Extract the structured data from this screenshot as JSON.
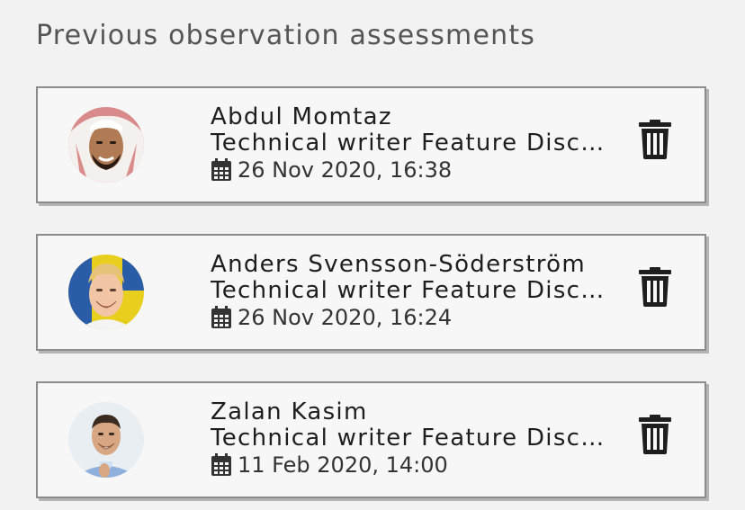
{
  "section": {
    "title": "Previous observation assessments"
  },
  "assessments": [
    {
      "name": "Abdul Momtaz",
      "description": "Technical writer Feature Discussion",
      "date": "26 Nov 2020, 16:38",
      "avatar": "avatar-photo-man-keffiyeh"
    },
    {
      "name": "Anders Svensson-Söderström",
      "description": "Technical writer Feature Discussion",
      "date": "26 Nov 2020, 16:24",
      "avatar": "avatar-photo-blond-man"
    },
    {
      "name": "Zalan Kasim",
      "description": "Technical writer Feature Discussion",
      "date": "11 Feb 2020, 14:00",
      "avatar": "avatar-photo-man-blue-shirt"
    }
  ],
  "icons": {
    "date": "calendar-icon",
    "delete": "trash-icon"
  },
  "colors": {
    "background": "#f2f2f2",
    "card_border": "#8c8c8c",
    "text": "#1e1e1e",
    "heading": "#555555"
  }
}
